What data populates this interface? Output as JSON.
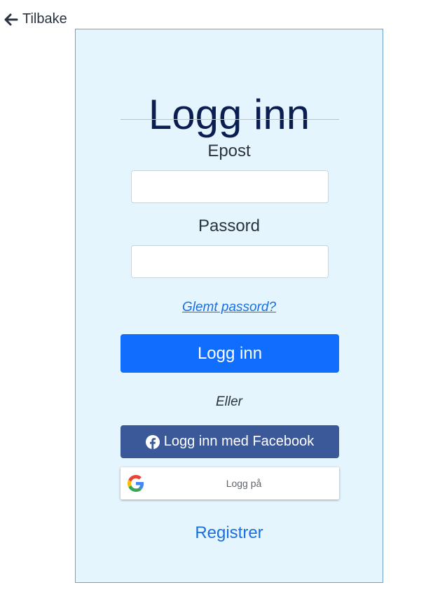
{
  "back": {
    "label": "Tilbake",
    "icon": "arrow-left-icon"
  },
  "login": {
    "title": "Logg inn",
    "email_label": "Epost",
    "email_value": "",
    "password_label": "Passord",
    "password_value": "",
    "forgot_label": "Glemt passord?",
    "submit_label": "Logg inn",
    "or_label": "Eller",
    "facebook_label": "Logg inn med Facebook",
    "facebook_icon": "facebook-icon",
    "google_label": "Logg på",
    "google_icon": "google-icon",
    "register_label": "Registrer"
  },
  "colors": {
    "card_background": "#e5f5fd",
    "primary": "#0f6efd",
    "facebook": "#3b5898",
    "link": "#1a6fe0",
    "title": "#0b1e52"
  }
}
